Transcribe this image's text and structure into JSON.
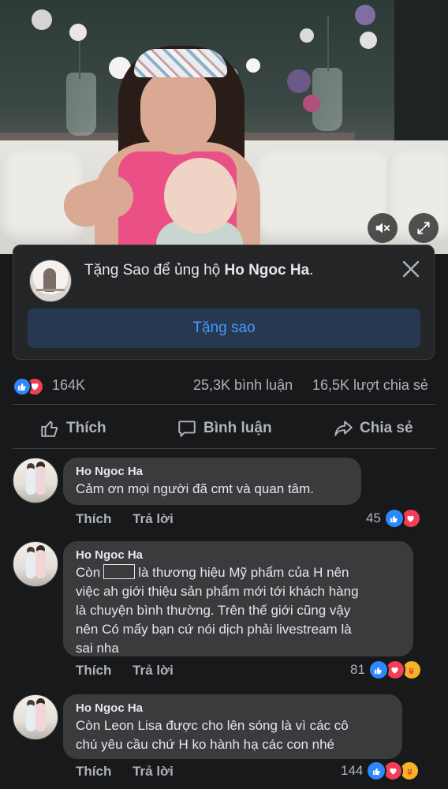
{
  "star_prompt": {
    "message_prefix": "Tặng Sao để ủng hộ",
    "page_name": "Ho Ngoc Ha",
    "message_suffix": ".",
    "button_label": "Tặng sao"
  },
  "stats": {
    "reactions_count": "164K",
    "comments": "25,3K bình luận",
    "shares": "16,5K lượt chia sẻ"
  },
  "actions": {
    "like": "Thích",
    "comment": "Bình luận",
    "share": "Chia sẻ"
  },
  "comments": [
    {
      "author": "Ho Ngoc Ha",
      "lines": [
        "Cảm ơn mọi người đã cmt và quan tâm."
      ],
      "like_label": "Thích",
      "reply_label": "Trả lời",
      "reaction_count": "45",
      "reactions": [
        "like-icon",
        "love-icon"
      ]
    },
    {
      "author": "Ho Ngoc Ha",
      "lines_first_prefix": "Còn",
      "lines_first_suffix": "là thương hiệu Mỹ phẩm của H nên",
      "lines": [
        "việc ah giới thiệu sản phẩm mới tới khách hàng",
        "là chuyện bình thường. Trên thế giới cũng vậy",
        "nên Có mấy bạn cứ nói dịch phải livestream là",
        "sai nha"
      ],
      "like_label": "Thích",
      "reply_label": "Trả lời",
      "reaction_count": "81",
      "reactions": [
        "like-icon",
        "love-icon",
        "care-icon"
      ]
    },
    {
      "author": "Ho Ngoc Ha",
      "lines": [
        "Còn Leon Lisa được cho lên sóng là vì các cô",
        "chú yêu cầu chứ H ko hành hạ các con nhé"
      ],
      "like_label": "Thích",
      "reply_label": "Trả lời",
      "reaction_count": "144",
      "reactions": [
        "like-icon",
        "love-icon",
        "care-icon"
      ]
    }
  ],
  "colors": {
    "background": "#18191a",
    "card": "#242526",
    "bubble": "#3a3b3c",
    "accent_blue": "#4599ff",
    "like_blue": "#2d88ff",
    "love_red": "#f33e58",
    "care_yellow": "#f7b125"
  }
}
